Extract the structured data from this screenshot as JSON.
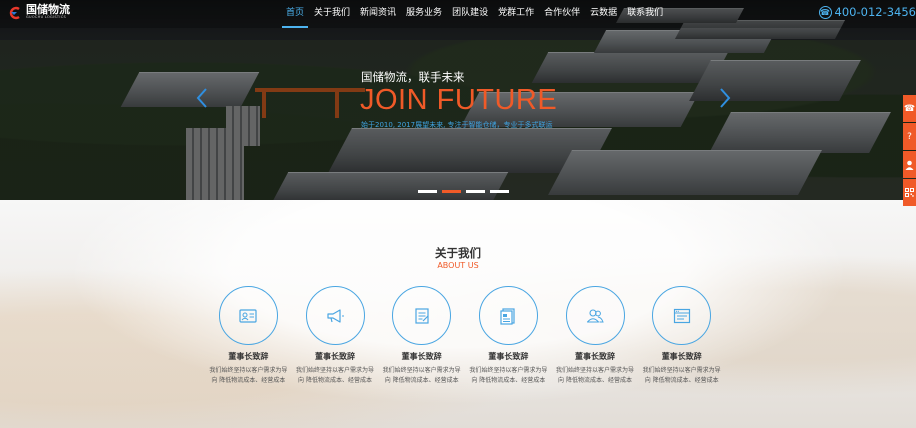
{
  "header": {
    "logo_text": "国储物流",
    "logo_sub": "GUOCHU LOGISTICS",
    "nav": [
      "首页",
      "关于我们",
      "新闻资讯",
      "服务业务",
      "团队建设",
      "党群工作",
      "合作伙伴",
      "云数据",
      "联系我们"
    ],
    "phone": "400-012-3456"
  },
  "slider": {
    "title": "国储物流，联手未来",
    "headline": "JOIN FUTURE",
    "subtitle": "始于2010, 2017展望未来, 专注于智能仓储，专业于多式联运",
    "slide_count": 4,
    "active_slide": 1
  },
  "float_bar": {
    "icons": [
      "phone-icon",
      "question-icon",
      "user-icon",
      "qrcode-icon"
    ]
  },
  "about": {
    "title": "关于我们",
    "subtitle": "ABOUT US",
    "cards": [
      {
        "title": "董事长致辞",
        "desc": "我们始终坚持以客户需求为导向 降低物流成本、经营成本",
        "icon": "id-card-icon"
      },
      {
        "title": "董事长致辞",
        "desc": "我们始终坚持以客户需求为导向 降低物流成本、经营成本",
        "icon": "megaphone-icon"
      },
      {
        "title": "董事长致辞",
        "desc": "我们始终坚持以客户需求为导向 降低物流成本、经营成本",
        "icon": "edit-note-icon"
      },
      {
        "title": "董事长致辞",
        "desc": "我们始终坚持以客户需求为导向 降低物流成本、经营成本",
        "icon": "document-icon"
      },
      {
        "title": "董事长致辞",
        "desc": "我们始终坚持以客户需求为导向 降低物流成本、经营成本",
        "icon": "users-icon"
      },
      {
        "title": "董事长致辞",
        "desc": "我们始终坚持以客户需求为导向 降低物流成本、经营成本",
        "icon": "browser-window-icon"
      }
    ]
  },
  "colors": {
    "accent_blue": "#4db3ef",
    "accent_orange": "#f05a28"
  }
}
